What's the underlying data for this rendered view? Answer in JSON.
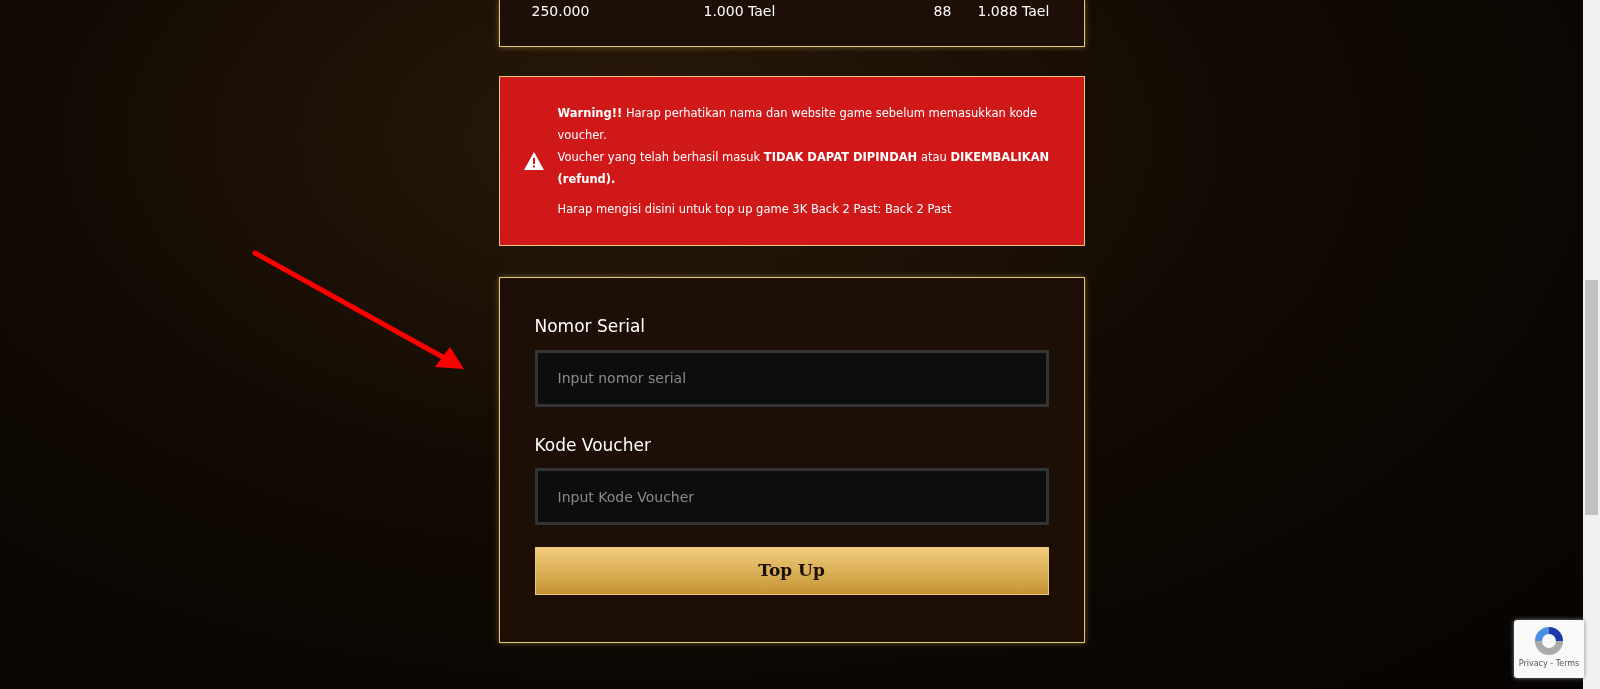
{
  "bonus_table": {
    "rows": [
      {
        "cells": [
          "250.000",
          "1.000 Tael",
          "88",
          "1.088 Tael"
        ]
      }
    ]
  },
  "warning": {
    "lines": [
      "**Warning!!** Harap perhatikan nama dan website game sebelum memasukkan kode voucher.",
      "Voucher yang telah berhasil masuk **TIDAK DAPAT DIPINDAH** atau **DIKEMBALIKAN (refund).**"
    ],
    "note": "Harap mengisi disini untuk top up game 3K Back 2 Past: Back 2 Past"
  },
  "form": {
    "fields": [
      {
        "label": "Nomor Serial",
        "placeholder": "Input nomor serial"
      },
      {
        "label": "Kode Voucher",
        "placeholder": "Input Kode Voucher"
      }
    ],
    "submit": "Top Up"
  },
  "recaptcha": {
    "links": "Privacy - Terms"
  }
}
